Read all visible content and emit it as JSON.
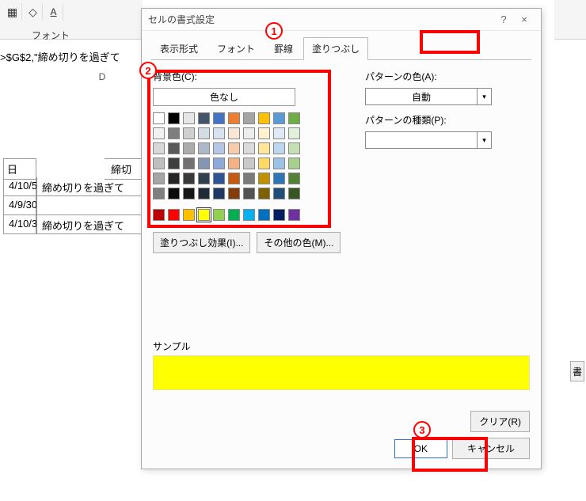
{
  "ribbon": {
    "font_group_label": "フォント"
  },
  "formula_bar_fragment": ">$G$2,\"締め切りを過ぎて",
  "column_header_d": "D",
  "table": {
    "hdr_day": "日",
    "hdr_due": "締切",
    "rows": [
      {
        "date": "4/10/5",
        "status": "締め切りを過ぎて"
      },
      {
        "date": "4/9/30",
        "status": ""
      },
      {
        "date": "4/10/3",
        "status": "締め切りを過ぎて"
      }
    ]
  },
  "dialog": {
    "title": "セルの書式設定",
    "help": "?",
    "close": "×",
    "tabs": [
      "表示形式",
      "フォント",
      "罫線",
      "塗りつぶし"
    ],
    "bgcolor_label": "背景色(C):",
    "nocolor": "色なし",
    "fill_effects": "塗りつぶし効果(I)...",
    "other_colors": "その他の色(M)...",
    "pattern_color_label": "パターンの色(A):",
    "pattern_color_value": "自動",
    "pattern_type_label": "パターンの種類(P):",
    "sample_label": "サンプル",
    "clear": "クリア(R)",
    "ok": "OK",
    "cancel": "キャンセル"
  },
  "palette": {
    "row1": [
      "#ffffff",
      "#000000",
      "#e7e6e6",
      "#44546a",
      "#4472c4",
      "#ed7d31",
      "#a5a5a5",
      "#ffc000",
      "#5b9bd5",
      "#70ad47"
    ],
    "row2": [
      "#f2f2f2",
      "#7f7f7f",
      "#d0cece",
      "#d6dce4",
      "#d9e2f3",
      "#fbe5d5",
      "#ededed",
      "#fff2cc",
      "#deebf6",
      "#e2efd9"
    ],
    "row3": [
      "#d8d8d8",
      "#595959",
      "#aeabab",
      "#adb9ca",
      "#b4c6e7",
      "#f7cbac",
      "#dbdbdb",
      "#fee599",
      "#bdd7ee",
      "#c5e0b3"
    ],
    "row4": [
      "#bfbfbf",
      "#3f3f3f",
      "#757070",
      "#8496b0",
      "#8eaadb",
      "#f4b183",
      "#c9c9c9",
      "#ffd965",
      "#9cc3e5",
      "#a8d08d"
    ],
    "row5": [
      "#a5a5a5",
      "#262626",
      "#3a3838",
      "#323f4f",
      "#2f5496",
      "#c55a11",
      "#7b7b7b",
      "#bf9000",
      "#2e75b5",
      "#538135"
    ],
    "row6": [
      "#7f7f7f",
      "#0c0c0c",
      "#171616",
      "#222a35",
      "#1f3864",
      "#833c0b",
      "#525252",
      "#7f6000",
      "#1e4e79",
      "#375623"
    ],
    "row7": [
      "#c00000",
      "#ff0000",
      "#ffc000",
      "#ffff00",
      "#92d050",
      "#00b050",
      "#00b0f0",
      "#0070c0",
      "#002060",
      "#7030a0"
    ]
  },
  "annotations": {
    "n1": "1",
    "n2": "2",
    "n3": "3"
  },
  "right_ribbon_text": "書",
  "side_btn": "書"
}
